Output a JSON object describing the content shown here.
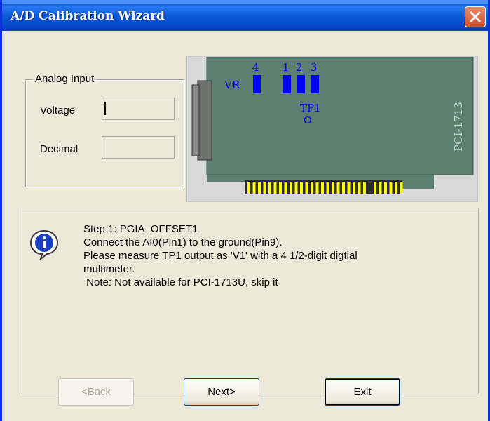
{
  "window": {
    "title": "A/D Calibration Wizard",
    "close_icon": "close-icon"
  },
  "analog_input": {
    "group_label": "Analog Input",
    "voltage_label": "Voltage",
    "voltage_value": "",
    "decimal_label": "Decimal",
    "decimal_value": ""
  },
  "board": {
    "vr_label": "VR",
    "vr_numbers": [
      "4",
      "1",
      "2",
      "3"
    ],
    "tp_label": "TP1",
    "tp_marker": "O",
    "model_label": "PCI-1713",
    "colors": {
      "board": "#5c7f72",
      "marker": "#0000ff",
      "connector": "#ffff00"
    }
  },
  "message": {
    "icon": "info-icon",
    "text": "Step 1: PGIA_OFFSET1\nConnect the AI0(Pin1) to the ground(Pin9).\nPlease measure TP1 output as 'V1' with a 4 1/2-digit digtial\nmultimeter.\n Note: Not available for PCI-1713U, skip it"
  },
  "buttons": {
    "back_label": "<Back",
    "back_enabled": false,
    "next_label": "Next>",
    "exit_label": "Exit"
  }
}
